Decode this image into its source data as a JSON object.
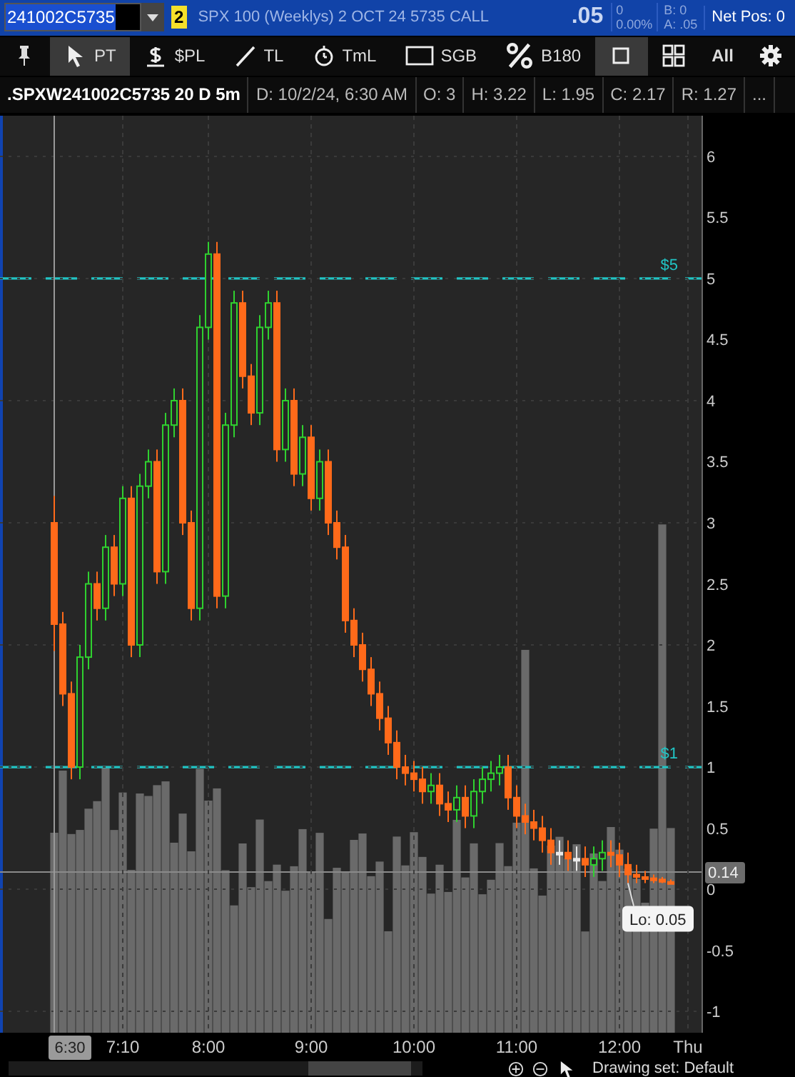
{
  "header": {
    "symbol": "241002C5735",
    "link_badge": "2",
    "description": "SPX 100 (Weeklys) 2 OCT 24 5735 CALL",
    "last": ".05",
    "change": "0",
    "change_percent": "0.00%",
    "bid": "B: 0",
    "ask": "A: .05",
    "net_position": "Net Pos: 0"
  },
  "toolbar": [
    {
      "kind": "pin",
      "selected": false
    },
    {
      "kind": "pointer",
      "label": "PT",
      "selected": true
    },
    {
      "kind": "dollar",
      "label": "$PL",
      "selected": false
    },
    {
      "kind": "line",
      "label": "TL",
      "selected": false
    },
    {
      "kind": "timer",
      "label": "TmL",
      "selected": false
    },
    {
      "kind": "rect",
      "label": "SGB",
      "selected": false
    },
    {
      "kind": "percent",
      "label": "B180",
      "selected": false
    },
    {
      "kind": "single",
      "selected": true
    },
    {
      "kind": "grid",
      "selected": false
    },
    {
      "kind": "all",
      "label": "All",
      "selected": false
    },
    {
      "kind": "gear",
      "selected": false
    }
  ],
  "info": [
    ".SPXW241002C5735 20 D 5m",
    "D: 10/2/24, 6:30 AM",
    "O: 3",
    "H: 3.22",
    "L: 1.95",
    "C: 2.17",
    "R: 1.27",
    "..."
  ],
  "chart": {
    "cursor_time": "6:30",
    "last_tag": "0.14",
    "price_lines": [
      {
        "label": "$5"
      },
      {
        "label": "$1"
      }
    ],
    "chart_data": {
      "type": "candlestick",
      "grid": true,
      "ylim": [
        -1.175,
        6.333
      ],
      "yticks": [
        {
          "value": 6,
          "label": "6"
        },
        {
          "value": 5.5,
          "label": "5.5"
        },
        {
          "value": 5,
          "label": "5"
        },
        {
          "value": 4.5,
          "label": "4.5"
        },
        {
          "value": 4,
          "label": "4"
        },
        {
          "value": 3.5,
          "label": "3.5"
        },
        {
          "value": 3,
          "label": "3"
        },
        {
          "value": 2.5,
          "label": "2.5"
        },
        {
          "value": 2,
          "label": "2"
        },
        {
          "value": 1.5,
          "label": "1.5"
        },
        {
          "value": 1,
          "label": "1"
        },
        {
          "value": 0.5,
          "label": "0.5"
        },
        {
          "value": 0,
          "label": "0"
        },
        {
          "value": -0.5,
          "label": "-0.5"
        },
        {
          "value": -1,
          "label": "-1"
        }
      ],
      "annotations": [
        {
          "y": 0.05,
          "text": "Lo: 0.05"
        }
      ],
      "categories": [
        null,
        null,
        null,
        null,
        null,
        null,
        null,
        null,
        "7:10",
        null,
        null,
        null,
        null,
        null,
        null,
        null,
        null,
        null,
        "8:00",
        null,
        null,
        null,
        null,
        null,
        null,
        null,
        null,
        null,
        null,
        null,
        "9:00",
        null,
        null,
        null,
        null,
        null,
        null,
        null,
        null,
        null,
        null,
        null,
        "10:00",
        null,
        null,
        null,
        null,
        null,
        null,
        null,
        null,
        null,
        null,
        null,
        "11:00",
        null,
        null,
        null,
        null,
        null,
        null,
        null,
        null,
        null,
        null,
        null,
        "12:00",
        null,
        null,
        null,
        null,
        null,
        null,
        null,
        "Thu"
      ],
      "ohlc": [
        [
          3,
          3.22,
          1.95,
          2.17
        ],
        [
          2.17,
          2.27,
          1.5,
          1.6
        ],
        [
          1.6,
          1.7,
          0.9,
          1.0
        ],
        [
          1.0,
          2.0,
          0.9,
          1.9
        ],
        [
          1.9,
          2.6,
          1.8,
          2.5
        ],
        [
          2.5,
          2.6,
          2.2,
          2.3
        ],
        [
          2.3,
          2.9,
          2.2,
          2.8
        ],
        [
          2.8,
          2.9,
          2.4,
          2.5
        ],
        [
          2.5,
          3.3,
          2.4,
          3.2
        ],
        [
          3.2,
          3.3,
          1.9,
          2.0
        ],
        [
          2.0,
          3.4,
          1.9,
          3.3
        ],
        [
          3.3,
          3.6,
          3.2,
          3.5
        ],
        [
          3.5,
          3.6,
          2.5,
          2.6
        ],
        [
          2.6,
          3.9,
          2.5,
          3.8
        ],
        [
          3.8,
          4.1,
          3.7,
          4.0
        ],
        [
          4.0,
          4.1,
          2.9,
          3.0
        ],
        [
          3.0,
          3.1,
          2.2,
          2.3
        ],
        [
          2.3,
          4.7,
          2.2,
          4.6
        ],
        [
          4.6,
          5.3,
          4.5,
          5.2
        ],
        [
          5.2,
          5.3,
          2.3,
          2.4
        ],
        [
          2.4,
          3.9,
          2.3,
          3.8
        ],
        [
          3.8,
          4.9,
          3.7,
          4.8
        ],
        [
          4.8,
          4.9,
          4.1,
          4.2
        ],
        [
          4.2,
          4.3,
          3.8,
          3.9
        ],
        [
          3.9,
          4.7,
          3.8,
          4.6
        ],
        [
          4.6,
          4.9,
          4.5,
          4.8
        ],
        [
          4.8,
          4.9,
          3.5,
          3.6
        ],
        [
          3.6,
          4.1,
          3.5,
          4.0
        ],
        [
          4.0,
          4.1,
          3.3,
          3.4
        ],
        [
          3.4,
          3.8,
          3.3,
          3.7
        ],
        [
          3.7,
          3.8,
          3.1,
          3.2
        ],
        [
          3.2,
          3.6,
          3.1,
          3.5
        ],
        [
          3.5,
          3.6,
          2.9,
          3.0
        ],
        [
          3.0,
          3.1,
          2.7,
          2.8
        ],
        [
          2.8,
          2.9,
          2.1,
          2.2
        ],
        [
          2.2,
          2.3,
          1.9,
          2.0
        ],
        [
          2.0,
          2.1,
          1.7,
          1.8
        ],
        [
          1.8,
          1.9,
          1.5,
          1.6
        ],
        [
          1.6,
          1.7,
          1.3,
          1.4
        ],
        [
          1.4,
          1.5,
          1.1,
          1.2
        ],
        [
          1.2,
          1.3,
          0.9,
          1.0
        ],
        [
          1.0,
          1.1,
          0.85,
          0.95
        ],
        [
          0.95,
          1.05,
          0.8,
          0.9
        ],
        [
          0.9,
          1.0,
          0.7,
          0.8
        ],
        [
          0.8,
          0.95,
          0.7,
          0.85
        ],
        [
          0.85,
          0.95,
          0.6,
          0.7
        ],
        [
          0.7,
          0.8,
          0.55,
          0.65
        ],
        [
          0.65,
          0.85,
          0.55,
          0.75
        ],
        [
          0.75,
          0.85,
          0.5,
          0.6
        ],
        [
          0.6,
          0.9,
          0.5,
          0.8
        ],
        [
          0.8,
          1.0,
          0.7,
          0.9
        ],
        [
          0.9,
          1.05,
          0.8,
          0.95
        ],
        [
          0.95,
          1.1,
          0.85,
          1.0
        ],
        [
          1.0,
          1.1,
          0.65,
          0.75
        ],
        [
          0.75,
          0.85,
          0.5,
          0.6
        ],
        [
          0.6,
          0.7,
          0.45,
          0.55
        ],
        [
          0.55,
          0.65,
          0.4,
          0.5
        ],
        [
          0.5,
          0.6,
          0.3,
          0.4
        ],
        [
          0.4,
          0.5,
          0.2,
          0.3
        ],
        [
          0.3,
          0.4,
          0.2,
          0.3
        ],
        [
          0.3,
          0.4,
          0.15,
          0.25
        ],
        [
          0.25,
          0.35,
          0.15,
          0.25
        ],
        [
          0.25,
          0.35,
          0.1,
          0.2
        ],
        [
          0.2,
          0.35,
          0.1,
          0.25
        ],
        [
          0.25,
          0.4,
          0.15,
          0.3
        ],
        [
          0.3,
          0.4,
          0.18,
          0.28
        ],
        [
          0.28,
          0.38,
          0.1,
          0.2
        ],
        [
          0.2,
          0.3,
          0.05,
          0.12
        ],
        [
          0.12,
          0.2,
          0.05,
          0.1
        ],
        [
          0.1,
          0.15,
          0.05,
          0.09
        ],
        [
          0.09,
          0.12,
          0.05,
          0.08
        ],
        [
          0.08,
          0.1,
          0.05,
          0.06
        ],
        [
          0.06,
          0.08,
          0.05,
          0.05
        ],
        null,
        null
      ]
    }
  },
  "footer": {
    "drawing_set": "Drawing set: Default"
  }
}
